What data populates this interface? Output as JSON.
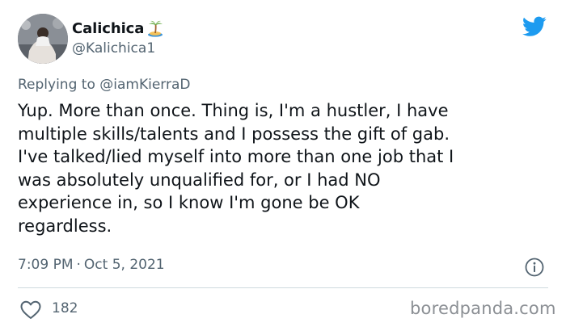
{
  "author": {
    "display_name": "Calichica",
    "handle": "@Kalichica1",
    "name_emoji": "desert-island-emoji",
    "avatar": "user-avatar-photo"
  },
  "reply": {
    "prefix": "Replying to ",
    "to": "@iamKierraD"
  },
  "tweet": {
    "text": "Yup. More than once. Thing is, I'm a hustler, I have\nmultiple skills/talents and I possess the gift of gab.\nI've talked/lied myself into more than one job that I\nwas absolutely unqualified for, or I had NO\nexperience in, so I know I'm gone be OK\nregardless.",
    "time": "7:09 PM",
    "separator": "·",
    "date": "Oct 5, 2021"
  },
  "stats": {
    "likes": "182"
  },
  "watermark": "boredpanda.com",
  "icons": {
    "brand": "twitter-bird-icon",
    "info": "info-icon",
    "like": "heart-icon"
  },
  "colors": {
    "text": "#0f1419",
    "secondary": "#536471",
    "twitter_blue": "#1d9bf0",
    "divider": "#cfd9de"
  }
}
